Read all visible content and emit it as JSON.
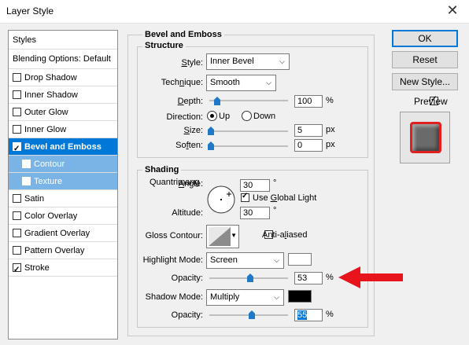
{
  "window": {
    "title": "Layer Style",
    "close_glyph": "✕"
  },
  "sidebar": {
    "header": "Styles",
    "blending": "Blending Options: Default",
    "items": [
      {
        "label": "Drop Shadow",
        "checked": false
      },
      {
        "label": "Inner Shadow",
        "checked": false
      },
      {
        "label": "Outer Glow",
        "checked": false
      },
      {
        "label": "Inner Glow",
        "checked": false
      },
      {
        "label": "Bevel and Emboss",
        "checked": true
      },
      {
        "label": "Contour",
        "checked": false
      },
      {
        "label": "Texture",
        "checked": false
      },
      {
        "label": "Satin",
        "checked": false
      },
      {
        "label": "Color Overlay",
        "checked": false
      },
      {
        "label": "Gradient Overlay",
        "checked": false
      },
      {
        "label": "Pattern Overlay",
        "checked": false
      },
      {
        "label": "Stroke",
        "checked": true
      }
    ]
  },
  "bevel": {
    "section_title": "Bevel and Emboss",
    "structure": {
      "title": "Structure",
      "style_label": "Style:",
      "style_value": "Inner Bevel",
      "technique_label": "Technique:",
      "technique_value": "Smooth",
      "depth_label": "Depth:",
      "depth_value": "100",
      "depth_unit": "%",
      "direction_label": "Direction:",
      "direction_up": "Up",
      "direction_down": "Down",
      "size_label": "Size:",
      "size_value": "5",
      "size_unit": "px",
      "soften_label": "Soften:",
      "soften_value": "0",
      "soften_unit": "px"
    },
    "shading": {
      "title": "Shading",
      "angle_label": "Angle:",
      "angle_value": "30",
      "angle_unit": "°",
      "global_light_label": "Use Global Light",
      "altitude_label": "Altitude:",
      "altitude_value": "30",
      "altitude_unit": "°",
      "gloss_label": "Gloss Contour:",
      "antialiased_label": "Anti-aliased",
      "highlight_mode_label": "Highlight Mode:",
      "highlight_mode_value": "Screen",
      "highlight_color": "#ffffff",
      "highlight_opacity_label": "Opacity:",
      "highlight_opacity_value": "53",
      "highlight_opacity_unit": "%",
      "shadow_mode_label": "Shadow Mode:",
      "shadow_mode_value": "Multiply",
      "shadow_color": "#000000",
      "shadow_opacity_label": "Opacity:",
      "shadow_opacity_value": "55",
      "shadow_opacity_unit": "%"
    }
  },
  "buttons": {
    "ok": "OK",
    "reset": "Reset",
    "new_style": "New Style...",
    "preview": "Preview"
  },
  "watermark": "Quantrimang",
  "accent_color": "#0078d7",
  "arrow_color": "#e8141c"
}
